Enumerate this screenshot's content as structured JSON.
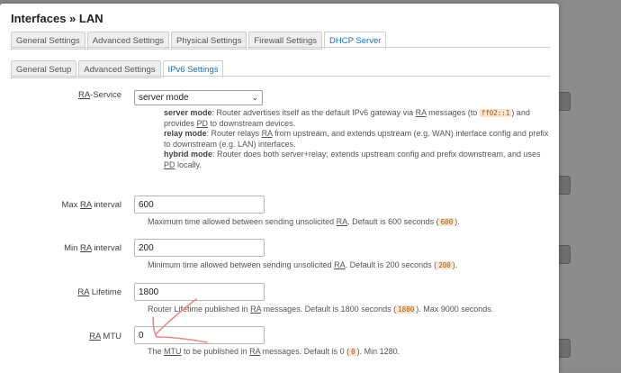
{
  "dialog": {
    "title": "Interfaces » LAN"
  },
  "main_tabs": [
    {
      "label": "General Settings",
      "active": false
    },
    {
      "label": "Advanced Settings",
      "active": false
    },
    {
      "label": "Physical Settings",
      "active": false
    },
    {
      "label": "Firewall Settings",
      "active": false
    },
    {
      "label": "DHCP Server",
      "active": true
    }
  ],
  "sub_tabs": [
    {
      "label": "General Setup",
      "active": false
    },
    {
      "label": "Advanced Settings",
      "active": false
    },
    {
      "label": "IPv6 Settings",
      "active": true
    }
  ],
  "ra_service": {
    "label_abbr": "RA",
    "label_rest": "-Service",
    "value": "server mode",
    "help": {
      "server_mode_term": "server mode",
      "server_mode_text_1": ": Router advertises itself as the default IPv6 gateway via ",
      "server_mode_ra": "RA",
      "server_mode_text_2": " messages (to ",
      "server_mode_code": "ff02::1",
      "server_mode_text_3": ") and provides ",
      "server_mode_pd": "PD",
      "server_mode_text_4": " to downstream devices.",
      "relay_mode_term": "relay mode",
      "relay_mode_text_1": ": Router relays ",
      "relay_mode_ra": "RA",
      "relay_mode_text_2": " from upstream, and extends upstream (e.g. WAN) interface config and prefix to downstream (e.g. LAN) interfaces.",
      "hybrid_mode_term": "hybrid mode",
      "hybrid_mode_text_1": ": Router does both server+relay; extends upstream config and prefix downstream, and uses ",
      "hybrid_mode_pd": "PD",
      "hybrid_mode_text_2": " locally."
    }
  },
  "max_ra_interval": {
    "label_pre": "Max ",
    "label_abbr": "RA",
    "label_post": " interval",
    "value": "600",
    "help_1": "Maximum time allowed between sending unsolicited ",
    "help_ra": "RA",
    "help_2": ". Default is 600 seconds (",
    "help_code": "600",
    "help_3": ")."
  },
  "min_ra_interval": {
    "label_pre": "Min ",
    "label_abbr": "RA",
    "label_post": " interval",
    "value": "200",
    "help_1": "Minimum time allowed between sending unsolicited ",
    "help_ra": "RA",
    "help_2": ". Default is 200 seconds (",
    "help_code": "200",
    "help_3": ")."
  },
  "ra_lifetime": {
    "label_abbr": "RA",
    "label_post": " Lifetime",
    "value": "1800",
    "help_1": "Router Lifetime published in ",
    "help_ra": "RA",
    "help_2": " messages. Default is 1800 seconds (",
    "help_code": "1800",
    "help_3": "). Max 9000 seconds."
  },
  "ra_mtu": {
    "label_abbr": "RA",
    "label_post": " MTU",
    "value": "0",
    "help_1": "The ",
    "help_mtu": "MTU",
    "help_2": " to be published in ",
    "help_ra": "RA",
    "help_3": " messages. Default is 0 (",
    "help_code": "0",
    "help_4": "). Min 1280."
  },
  "colors": {
    "active_tab": "#1a6fb5",
    "code_bg": "#fbe4cc",
    "arrow": "#e88a8a"
  }
}
